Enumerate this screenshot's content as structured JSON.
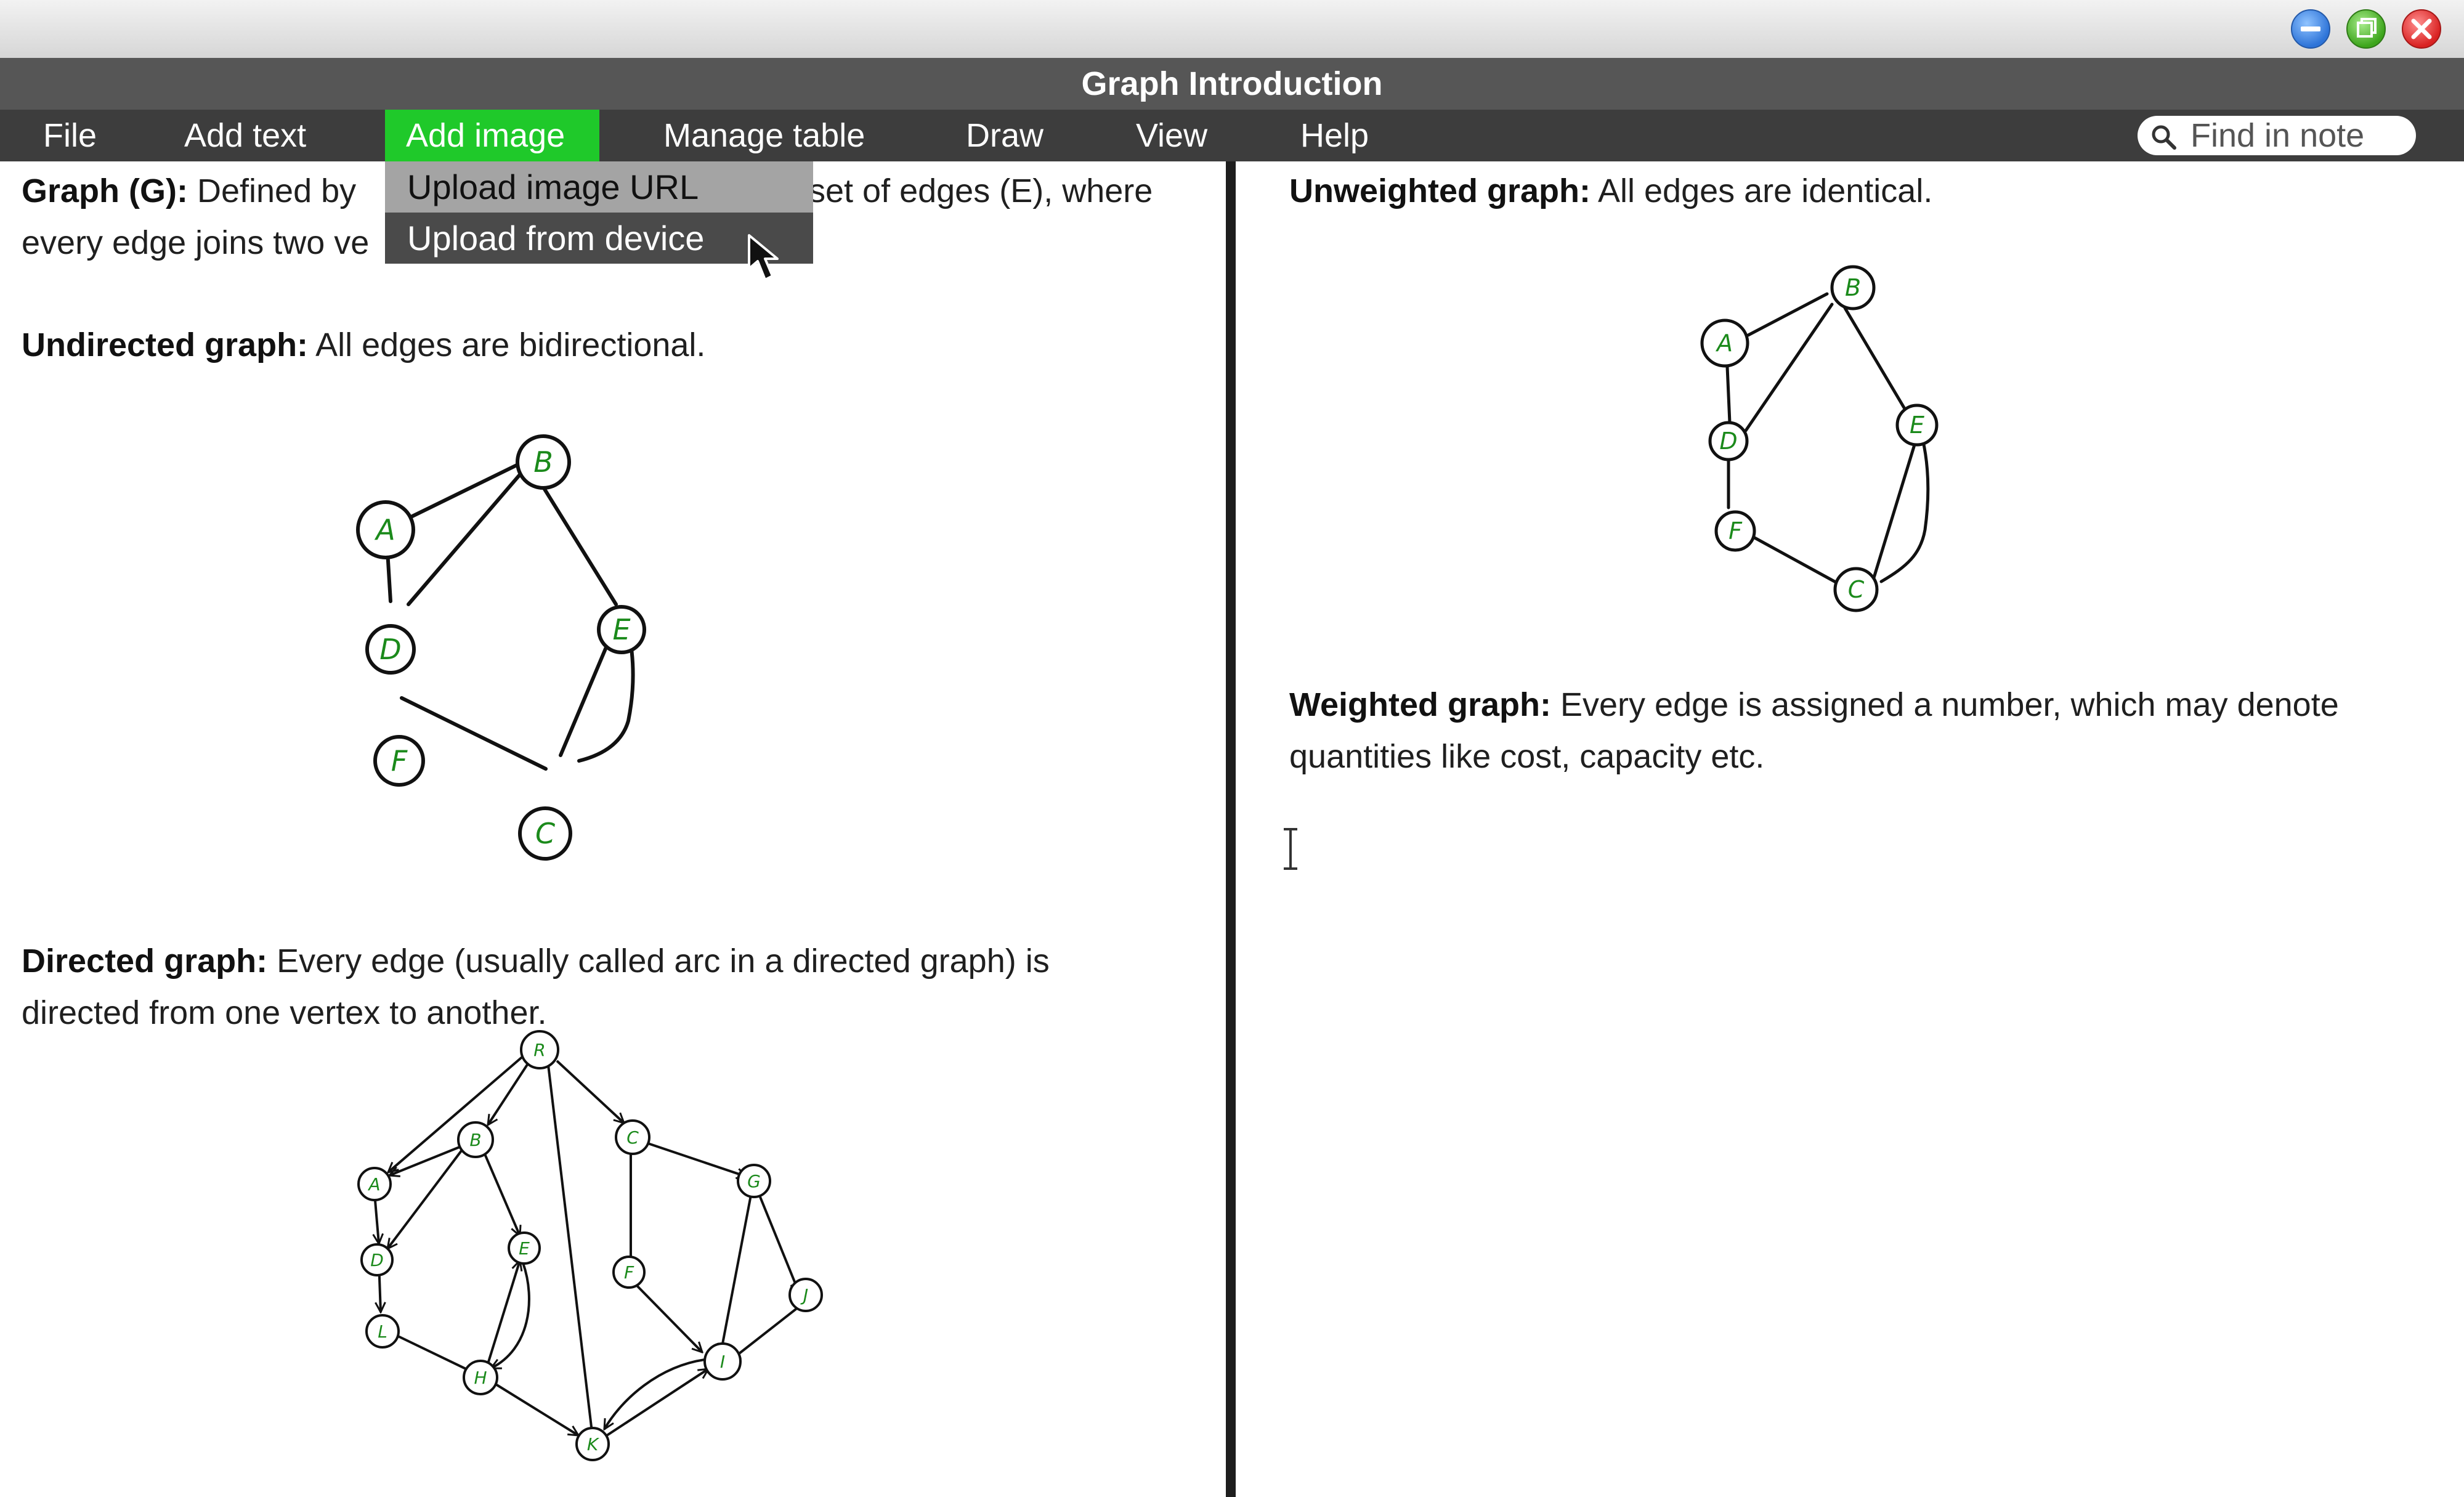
{
  "window": {
    "controls": [
      "minimize-icon",
      "maximize-icon",
      "close-icon"
    ],
    "control_colors": {
      "minimize": "#2e74d8",
      "maximize": "#3da51c",
      "close": "#d92222"
    }
  },
  "app": {
    "title": "Graph Introduction"
  },
  "menu": {
    "items": [
      "File",
      "Add text",
      "Add image",
      "Manage table",
      "Draw",
      "View",
      "Help"
    ],
    "active": "Add image",
    "active_color": "#1fc92a"
  },
  "search": {
    "placeholder": "Find in note",
    "icon": "search-icon"
  },
  "dropdown": {
    "items": [
      "Upload image URL",
      "Upload from device"
    ],
    "hovered": "Upload from device"
  },
  "left": {
    "p1": {
      "term": "Graph (G):",
      "text_before": " Defined by ",
      "text_after": "set of edges (E), where",
      "line2": "every edge joins two ve"
    },
    "p2": {
      "term": "Undirected graph:",
      "text": " All edges are bidirectional."
    },
    "p3": {
      "term": "Directed graph:",
      "text": " Every edge (usually called arc in a directed graph) is",
      "line2": "directed from one vertex to another."
    }
  },
  "right": {
    "p1": {
      "term": "Unweighted graph:",
      "text": " All edges are identical."
    },
    "p2": {
      "term": "Weighted graph:",
      "text": " Every edge is assigned a number, which may denote",
      "line2": "quantities like cost, capacity etc."
    }
  },
  "graphs": {
    "undirected": {
      "nodes": [
        "A",
        "B",
        "D",
        "E",
        "F",
        "C"
      ],
      "edges": [
        [
          "A",
          "B"
        ],
        [
          "A",
          "D"
        ],
        [
          "B",
          "D"
        ],
        [
          "B",
          "E"
        ],
        [
          "D",
          "F"
        ],
        [
          "F",
          "C"
        ],
        [
          "E",
          "C"
        ],
        [
          "E",
          "C"
        ]
      ]
    },
    "directed": {
      "nodes": [
        "R",
        "A",
        "B",
        "C",
        "G",
        "D",
        "E",
        "F",
        "J",
        "L",
        "H",
        "I",
        "K"
      ],
      "edges": [
        [
          "R",
          "A"
        ],
        [
          "R",
          "B"
        ],
        [
          "R",
          "C"
        ],
        [
          "B",
          "A"
        ],
        [
          "B",
          "D"
        ],
        [
          "B",
          "E"
        ],
        [
          "A",
          "D"
        ],
        [
          "D",
          "L"
        ],
        [
          "L",
          "H"
        ],
        [
          "H",
          "E"
        ],
        [
          "E",
          "H"
        ],
        [
          "H",
          "K"
        ],
        [
          "K",
          "R"
        ],
        [
          "C",
          "F"
        ],
        [
          "C",
          "G"
        ],
        [
          "G",
          "I"
        ],
        [
          "G",
          "J"
        ],
        [
          "J",
          "I"
        ],
        [
          "F",
          "I"
        ],
        [
          "K",
          "I"
        ],
        [
          "I",
          "K"
        ]
      ]
    },
    "unweighted": {
      "nodes": [
        "A",
        "B",
        "D",
        "E",
        "F",
        "C"
      ],
      "edges": [
        [
          "A",
          "B"
        ],
        [
          "A",
          "D"
        ],
        [
          "B",
          "D"
        ],
        [
          "B",
          "E"
        ],
        [
          "D",
          "F"
        ],
        [
          "F",
          "C"
        ],
        [
          "E",
          "C"
        ],
        [
          "E",
          "C"
        ]
      ]
    }
  },
  "colors": {
    "node_label": "#1b8a1b",
    "edge": "#111111"
  }
}
